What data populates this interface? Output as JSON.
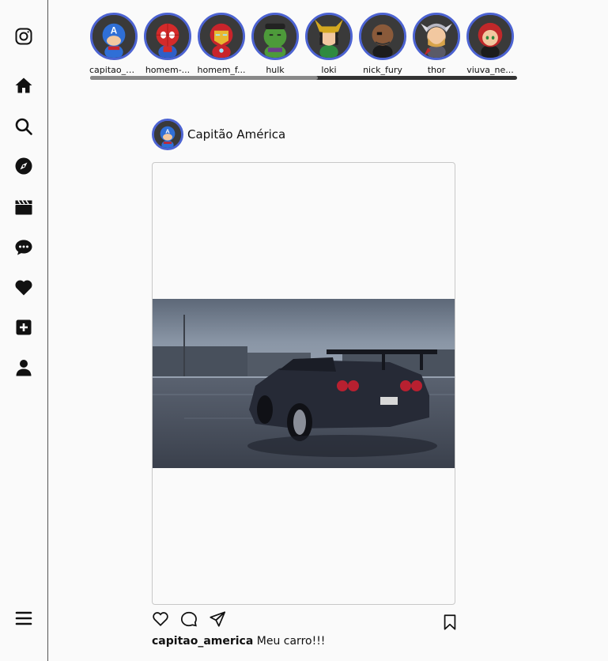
{
  "sidebar": {
    "items": [
      {
        "name": "instagram-logo-icon"
      },
      {
        "name": "home-icon"
      },
      {
        "name": "search-icon"
      },
      {
        "name": "explore-icon"
      },
      {
        "name": "reels-icon"
      },
      {
        "name": "messages-icon"
      },
      {
        "name": "notifications-icon"
      },
      {
        "name": "create-icon"
      },
      {
        "name": "profile-icon"
      },
      {
        "name": "menu-icon"
      }
    ]
  },
  "stories": [
    {
      "username": "capitao_a...",
      "color": "#2f6fd6"
    },
    {
      "username": "homem-...",
      "color": "#d42a2a"
    },
    {
      "username": "homem_f...",
      "color": "#c8242b"
    },
    {
      "username": "hulk",
      "color": "#4d9a3a"
    },
    {
      "username": "loki",
      "color": "#2f8a3f"
    },
    {
      "username": "nick_fury",
      "color": "#3a3a3a"
    },
    {
      "username": "thor",
      "color": "#9a9aa8"
    },
    {
      "username": "viuva_ne...",
      "color": "#c0282a"
    }
  ],
  "post": {
    "author_display": "Capitão América",
    "caption_user": "capitao_america",
    "caption_text": " Meu carro!!!"
  },
  "colors": {
    "story_ring": "#4c63d2",
    "border": "#c8c8c8"
  }
}
